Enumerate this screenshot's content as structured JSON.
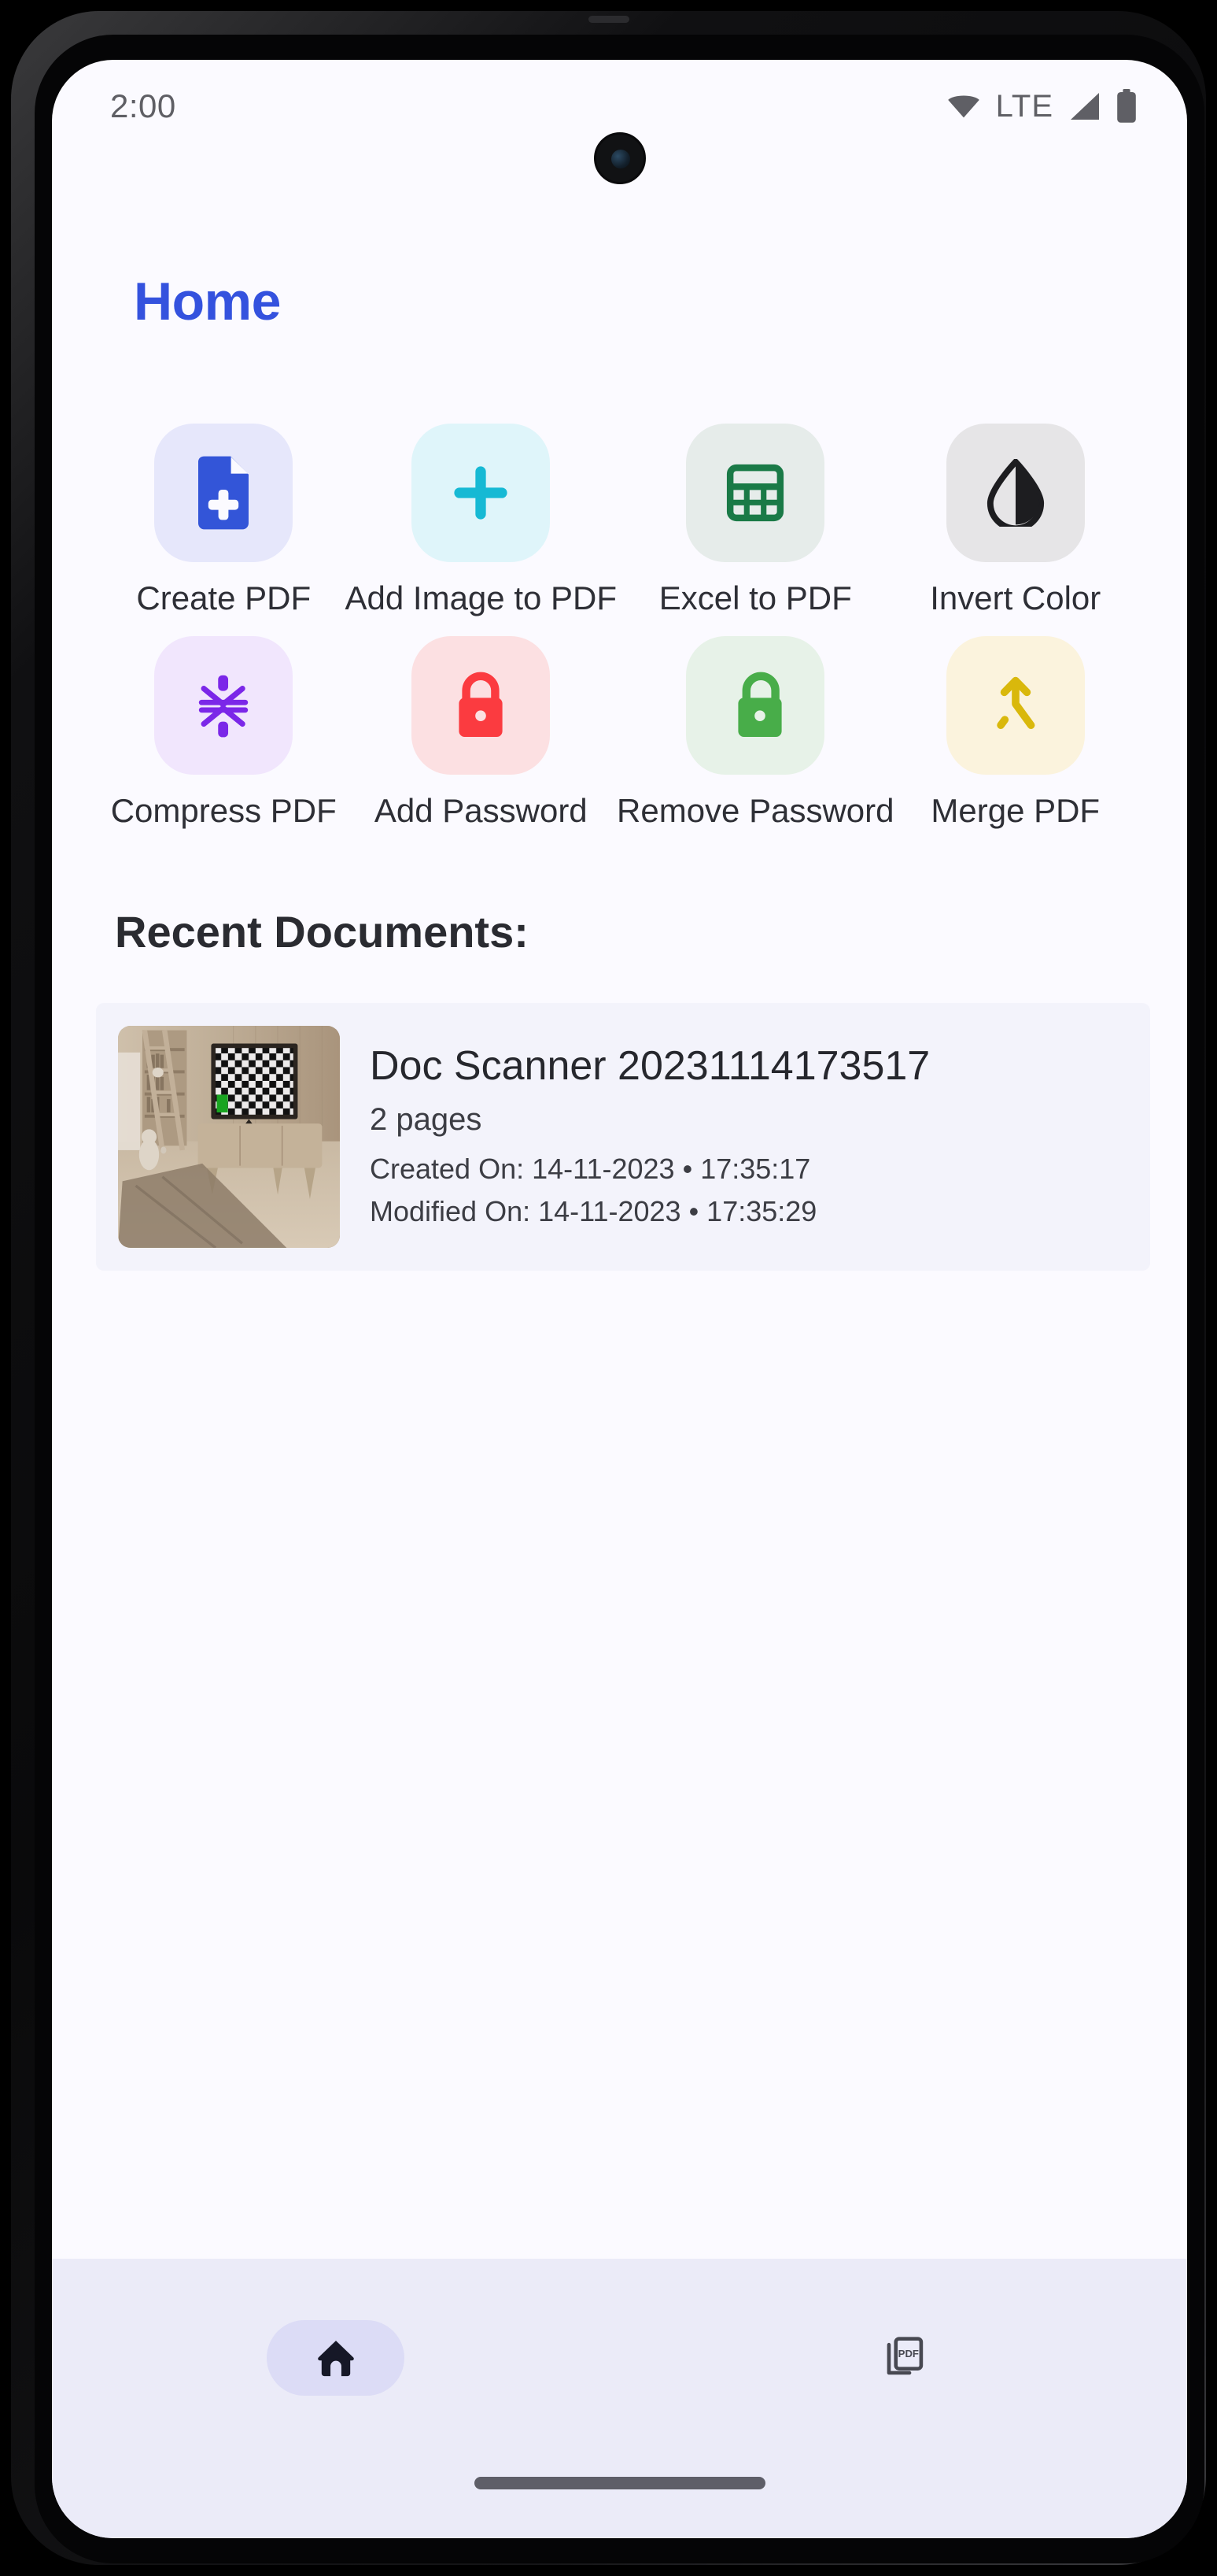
{
  "status_bar": {
    "clock": "2:00",
    "network_label": "LTE",
    "icons": [
      "wifi-icon",
      "signal-icon",
      "battery-icon"
    ]
  },
  "app_bar": {
    "title": "Home",
    "title_color": "#3452de"
  },
  "tools": [
    {
      "label": "Create PDF",
      "icon": "create-pdf-icon",
      "box_color": "#e6e7fb",
      "icon_color": "#3355d8"
    },
    {
      "label": "Add Image to PDF",
      "icon": "add-image-icon",
      "box_color": "#dff5fa",
      "icon_color": "#16b9d4"
    },
    {
      "label": "Excel to PDF",
      "icon": "excel-icon",
      "box_color": "#e6ecea",
      "icon_color": "#1a7a47"
    },
    {
      "label": "Invert Color",
      "icon": "invert-color-icon",
      "box_color": "#e6e5e7",
      "icon_color": "#1d1d20"
    },
    {
      "label": "Compress PDF",
      "icon": "compress-pdf-icon",
      "box_color": "#f1e6fd",
      "icon_color": "#7b27e8"
    },
    {
      "label": "Add Password",
      "icon": "lock-closed-icon",
      "box_color": "#fce0e2",
      "icon_color": "#fb3b40"
    },
    {
      "label": "Remove Password",
      "icon": "lock-open-icon",
      "box_color": "#e7f2e8",
      "icon_color": "#48ad49"
    },
    {
      "label": "Merge PDF",
      "icon": "merge-pdf-icon",
      "box_color": "#fbf3dd",
      "icon_color": "#d9b80c"
    }
  ],
  "recent": {
    "heading": "Recent Documents:",
    "documents": [
      {
        "title": "Doc Scanner 20231114173517",
        "pages": "2 pages",
        "created": "Created On: 14-11-2023 • 17:35:17",
        "modified": "Modified On: 14-11-2023 • 17:35:29",
        "thumbnail": "room-with-tv-thumbnail"
      }
    ]
  },
  "bottom_nav": {
    "items": [
      {
        "icon": "home-icon",
        "selected": true
      },
      {
        "icon": "pdf-documents-icon",
        "selected": false
      }
    ]
  }
}
